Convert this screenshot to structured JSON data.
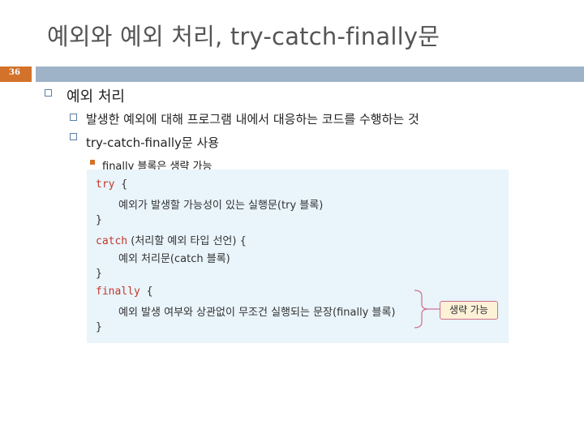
{
  "slide": {
    "title": "예외와 예외 처리, try-catch-finally문",
    "number": "36"
  },
  "bullets": {
    "level1": "예외 처리",
    "level2": [
      "발생한 예외에 대해 프로그램 내에서 대응하는 코드를 수행하는 것",
      "try-catch-finally문 사용"
    ],
    "level3": "finally 블록은 생략 가능"
  },
  "code": {
    "try_kw": "try",
    "open_brace": " {",
    "close_brace": "}",
    "try_body": "예외가 발생할 가능성이 있는 실행문(try 블록)",
    "catch_kw": "catch",
    "catch_args": " (처리할 예외 타입 선언) {",
    "catch_body": "예외 처리문(catch 블록)",
    "finally_kw": "finally",
    "finally_body": "예외 발생 여부와 상관없이 무조건 실행되는 문장(finally 블록)"
  },
  "callout": {
    "label": "생략 가능"
  },
  "colors": {
    "accent_orange": "#d3722b",
    "band_blue": "#9fb3c8",
    "keyword_red": "#c0392b",
    "code_bg": "#e9f4fb",
    "callout_border": "#cf6f8a"
  }
}
